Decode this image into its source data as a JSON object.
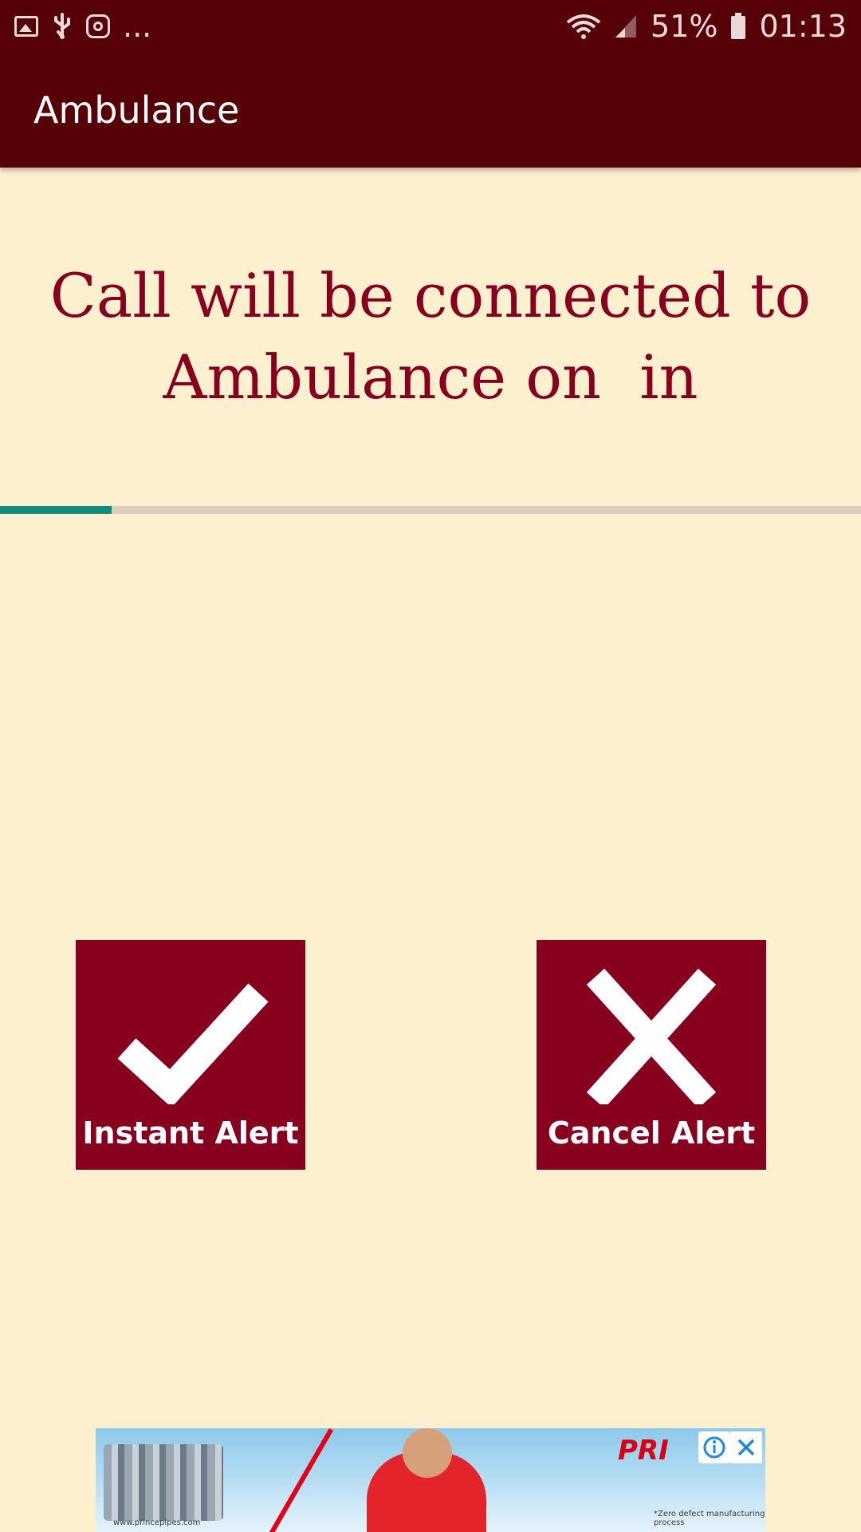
{
  "status_bar": {
    "more": "...",
    "battery": "51%",
    "time": "01:13"
  },
  "app_bar": {
    "title": "Ambulance"
  },
  "message": "Call will be connected to Ambulance on  in",
  "progress": {
    "fraction": 0.13,
    "fill_color": "#138a80"
  },
  "buttons": {
    "instant": {
      "label": "Instant Alert",
      "icon": "check-icon"
    },
    "cancel": {
      "label": "Cancel Alert",
      "icon": "close-icon"
    }
  },
  "ad": {
    "brand": "PRI",
    "url": "www.princepipes.com",
    "tagline": "*Zero defect manufacturing process"
  },
  "colors": {
    "primary_dark": "#560007",
    "accent": "#87001e",
    "background": "#fdf0cf"
  }
}
